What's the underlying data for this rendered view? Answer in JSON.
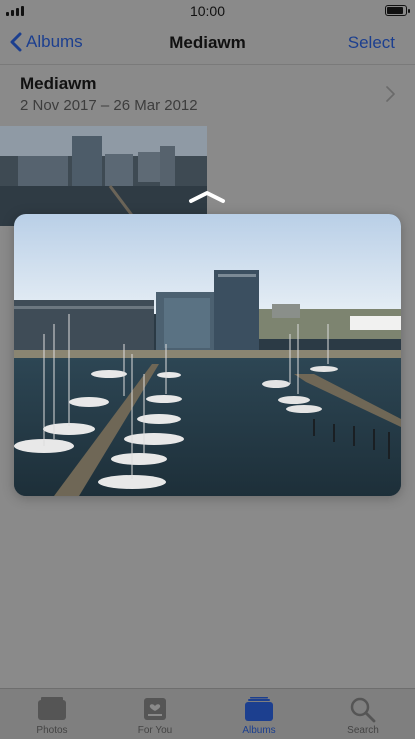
{
  "status": {
    "time": "10:00"
  },
  "nav": {
    "back_label": "Albums",
    "title": "Mediawm",
    "select_label": "Select"
  },
  "album": {
    "name": "Mediawm",
    "dates": "2 Nov 2017 – 26 Mar 2012"
  },
  "tabs": [
    {
      "label": "Photos",
      "icon": "photos-icon",
      "active": false
    },
    {
      "label": "For You",
      "icon": "for-you-icon",
      "active": false
    },
    {
      "label": "Albums",
      "icon": "albums-icon",
      "active": true
    },
    {
      "label": "Search",
      "icon": "search-icon",
      "active": false
    }
  ],
  "colors": {
    "accent": "#1c3f8f",
    "dim_background": "#8a8a8a"
  }
}
